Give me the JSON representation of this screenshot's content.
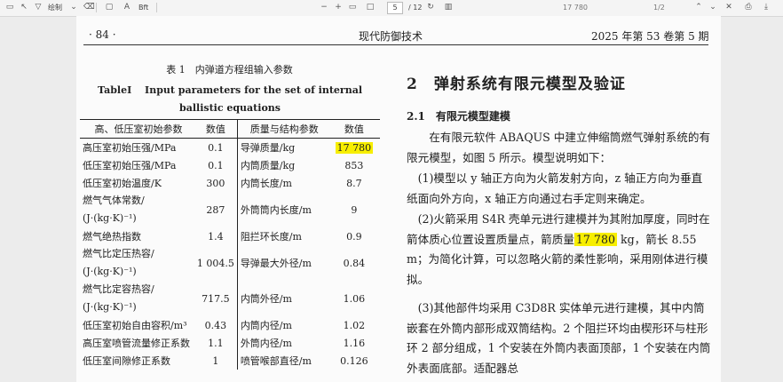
{
  "toolbar": {
    "draw_label": "绘制",
    "tool_label": "Bft",
    "page_current": "5",
    "page_total": "/ 12",
    "search_text": "17 780",
    "search_count": "1/2"
  },
  "header": {
    "page_no": "· 84 ·",
    "journal": "现代防御技术",
    "issue": "2025 年第 53 卷第 5 期"
  },
  "table": {
    "title_cn": "表 1　内弹道方程组输入参数",
    "title_en": "TableI　 Input parameters for the set of internal ballistic equations",
    "columns": [
      "高、低压室初始参数",
      "数值",
      "质量与结构参数",
      "数值"
    ],
    "rows": [
      {
        "p1": "高压室初始压强/MPa",
        "v1": "0.1",
        "p2": "导弹质量/kg",
        "v2": "17 780"
      },
      {
        "p1": "低压室初始压强/MPa",
        "v1": "0.1",
        "p2": "内筒质量/kg",
        "v2": "853"
      },
      {
        "p1": "低压室初始温度/K",
        "v1": "300",
        "p2": "内筒长度/m",
        "v2": "8.7"
      },
      {
        "p1": "燃气气体常数/",
        "p1b": "(J·(kg·K)⁻¹)",
        "v1": "287",
        "p2": "外筒筒内长度/m",
        "v2": "9"
      },
      {
        "p1": "燃气绝热指数",
        "v1": "1.4",
        "p2": "阻拦环长度/m",
        "v2": "0.9"
      },
      {
        "p1": "燃气比定压热容/",
        "p1b": "(J·(kg·K)⁻¹)",
        "v1": "1 004.5",
        "p2": "导弹最大外径/m",
        "v2": "0.84"
      },
      {
        "p1": "燃气比定容热容/",
        "p1b": "(J·(kg·K)⁻¹)",
        "v1": "717.5",
        "p2": "内筒外径/m",
        "v2": "1.06"
      },
      {
        "p1": "低压室初始自由容积/m³",
        "v1": "0.43",
        "p2": "内筒内径/m",
        "v2": "1.02"
      },
      {
        "p1": "高压室喷管流量修正系数",
        "v1": "1.1",
        "p2": "外筒内径/m",
        "v2": "1.16"
      },
      {
        "p1": "低压室间隙修正系数",
        "v1": "1",
        "p2": "喷管喉部直径/m",
        "v2": "0.126"
      }
    ]
  },
  "section": {
    "heading": "2　弹射系统有限元模型及验证",
    "sub_heading": "2.1　有限元模型建模",
    "p0": "在有限元软件 ABAQUS 中建立伸缩筒燃气弹射系统的有限元模型，如图 5 所示。模型说明如下：",
    "p1": "(1)模型以 y 轴正方向为火箭发射方向，z 轴正方向为垂直纸面向外方向，x 轴正方向通过右手定则来确定。",
    "p2_a": "(2)火箭采用 S4R 壳单元进行建模并为其附加厚度，同时在箭体质心位置设置质量点，箭质量",
    "p2_hl": "17 780",
    "p2_b": " kg，箭长 8.55 m；为简化计算，可以忽略火箭的柔性影响，采用刚体进行模拟。",
    "p3": "(3)其他部件均采用 C3D8R 实体单元进行建模，其中内筒嵌套在外筒内部形成双筒结构。2 个阻拦环均由楔形环与柱形环 2 部分组成，1 个安装在外筒内表面顶部，1 个安装在内筒外表面底部。适配器总"
  }
}
